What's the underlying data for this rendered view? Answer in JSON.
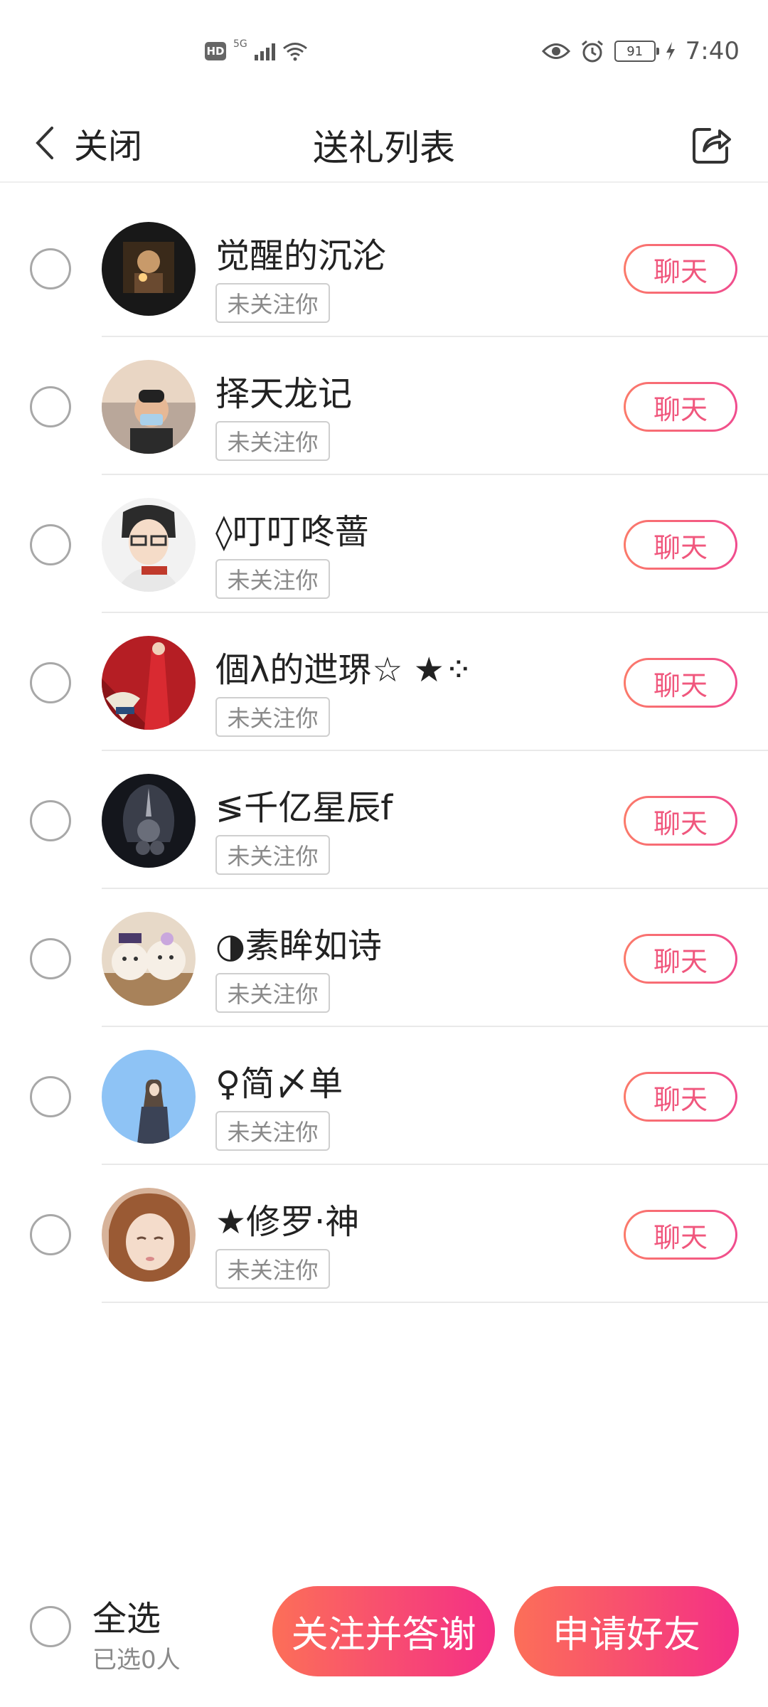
{
  "status_bar": {
    "hd": "HD",
    "network": "5G",
    "battery": "91",
    "time": "7:40"
  },
  "header": {
    "back_label": "关闭",
    "title": "送礼列表"
  },
  "list": [
    {
      "name": "觉醒的沉沦",
      "tag": "未关注你",
      "chat": "聊天"
    },
    {
      "name": "择天龙记",
      "tag": "未关注你",
      "chat": "聊天"
    },
    {
      "name": "◊叮叮咚蔷",
      "tag": "未关注你",
      "chat": "聊天"
    },
    {
      "name": "       個λ的迣琾☆ ★⁘",
      "tag": "未关注你",
      "chat": "聊天"
    },
    {
      "name": "≶千亿星辰f",
      "tag": "未关注你",
      "chat": "聊天"
    },
    {
      "name": "◑素眸如诗",
      "tag": "未关注你",
      "chat": "聊天"
    },
    {
      "name": "♀简〆单",
      "tag": "未关注你",
      "chat": "聊天"
    },
    {
      "name": "★修罗·神",
      "tag": "未关注你",
      "chat": "聊天"
    }
  ],
  "footer": {
    "select_all": "全选",
    "selected_count": "已选0人",
    "follow_thank": "关注并答谢",
    "add_friend": "申请好友"
  },
  "colors": {
    "accent_start": "#fc6f58",
    "accent_end": "#f42f86",
    "chat_text": "#f0577d"
  }
}
